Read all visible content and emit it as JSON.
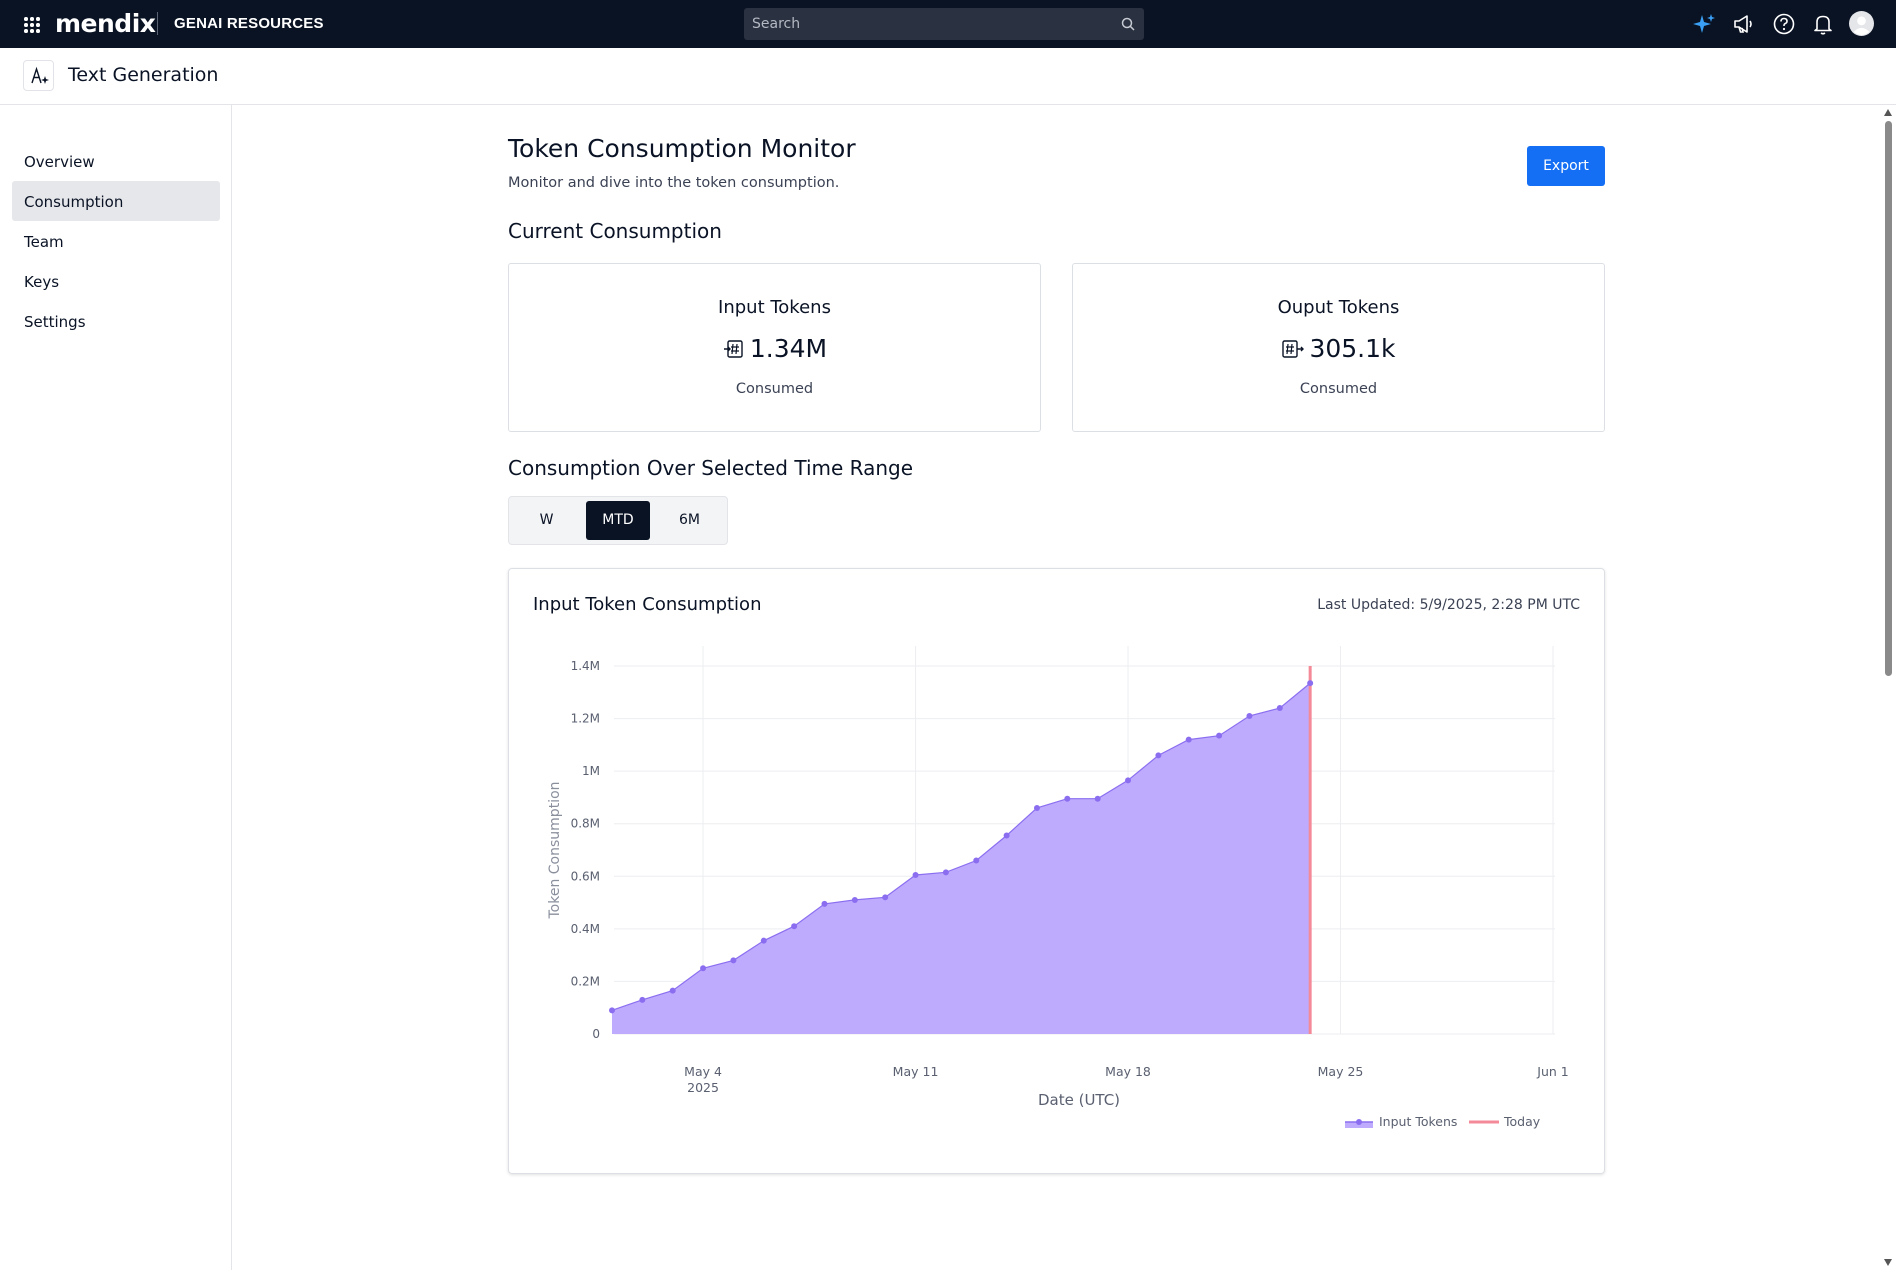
{
  "topbar": {
    "logo": "mendix",
    "product": "GENAI RESOURCES",
    "search_placeholder": "Search",
    "icons": [
      "apps-grid-icon",
      "sparkle-icon",
      "megaphone-icon",
      "help-icon",
      "bell-icon",
      "avatar-icon"
    ]
  },
  "subheader": {
    "title": "Text Generation",
    "icon": "ai-text-icon"
  },
  "sidebar": {
    "items": [
      {
        "label": "Overview",
        "active": false
      },
      {
        "label": "Consumption",
        "active": true
      },
      {
        "label": "Team",
        "active": false
      },
      {
        "label": "Keys",
        "active": false
      },
      {
        "label": "Settings",
        "active": false
      }
    ]
  },
  "main": {
    "title": "Token Consumption Monitor",
    "subtitle": "Monitor and dive into the token consumption.",
    "export_label": "Export",
    "current_section": "Current Consumption",
    "cards": [
      {
        "title": "Input Tokens",
        "value": "1.34M",
        "label": "Consumed",
        "icon": "token-input-icon"
      },
      {
        "title": "Ouput Tokens",
        "value": "305.1k",
        "label": "Consumed",
        "icon": "token-output-icon"
      }
    ],
    "range_section": "Consumption Over Selected Time Range",
    "range_options": [
      {
        "label": "W",
        "active": false
      },
      {
        "label": "MTD",
        "active": true
      },
      {
        "label": "6M",
        "active": false
      }
    ],
    "chart_title": "Input Token Consumption",
    "last_updated": "Last Updated: 5/9/2025, 2:28 PM UTC"
  },
  "colors": {
    "accent": "#146ff4",
    "area_fill": "#bfabfe",
    "line": "#8b6ef0",
    "today": "#f48a98",
    "topbar": "#0a1324"
  },
  "chart_data": {
    "type": "area",
    "xlabel": "Date (UTC)",
    "ylabel": "Token Consumption",
    "x_ticks": [
      {
        "date": "2025-05-04",
        "label": "May 4",
        "sublabel": "2025"
      },
      {
        "date": "2025-05-11",
        "label": "May 11",
        "sublabel": ""
      },
      {
        "date": "2025-05-18",
        "label": "May 18",
        "sublabel": ""
      },
      {
        "date": "2025-05-25",
        "label": "May 25",
        "sublabel": ""
      },
      {
        "date": "2025-06-01",
        "label": "Jun 1",
        "sublabel": ""
      }
    ],
    "y_ticks": [
      {
        "value": 0,
        "label": "0"
      },
      {
        "value": 200000,
        "label": "0.2M"
      },
      {
        "value": 400000,
        "label": "0.4M"
      },
      {
        "value": 600000,
        "label": "0.6M"
      },
      {
        "value": 800000,
        "label": "0.8M"
      },
      {
        "value": 1000000,
        "label": "1M"
      },
      {
        "value": 1200000,
        "label": "1.2M"
      },
      {
        "value": 1400000,
        "label": "1.4M"
      }
    ],
    "xlim": [
      "2025-05-01",
      "2025-06-01"
    ],
    "ylim": [
      0,
      1400000
    ],
    "grid": true,
    "legend_position": "bottom-right",
    "series": [
      {
        "name": "Input Tokens",
        "x": [
          "2025-05-01",
          "2025-05-02",
          "2025-05-03",
          "2025-05-04",
          "2025-05-05",
          "2025-05-06",
          "2025-05-07",
          "2025-05-08",
          "2025-05-09",
          "2025-05-10",
          "2025-05-11",
          "2025-05-12",
          "2025-05-13",
          "2025-05-14",
          "2025-05-15",
          "2025-05-16",
          "2025-05-17",
          "2025-05-18",
          "2025-05-19",
          "2025-05-20",
          "2025-05-21",
          "2025-05-22",
          "2025-05-23",
          "2025-05-24"
        ],
        "y": [
          90000,
          130000,
          165000,
          250000,
          280000,
          355000,
          410000,
          495000,
          510000,
          520000,
          605000,
          615000,
          660000,
          755000,
          860000,
          895000,
          895000,
          965000,
          1060000,
          1120000,
          1135000,
          1210000,
          1240000,
          1335000
        ]
      }
    ],
    "today": {
      "name": "Today",
      "date": "2025-05-24"
    }
  }
}
